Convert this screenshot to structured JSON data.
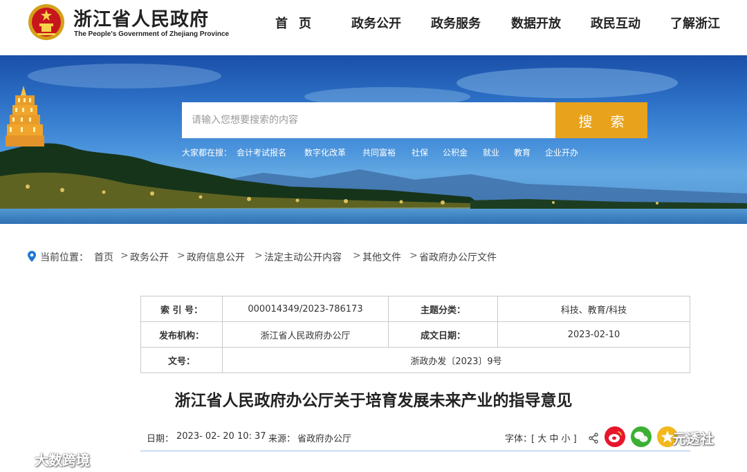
{
  "header": {
    "title": "浙江省人民政府",
    "subtitle": "The People's Government of Zhejiang Province",
    "nav": [
      "首页",
      "政务公开",
      "政务服务",
      "数据开放",
      "政民互动",
      "了解浙江"
    ]
  },
  "search": {
    "placeholder": "请输入您想要搜索的内容",
    "button_label": "搜 索",
    "hot_label": "大家都在搜：",
    "hot_links": [
      "会计考试报名",
      "数字化改革",
      "共同富裕",
      "社保",
      "公积金",
      "就业",
      "教育",
      "企业开办"
    ]
  },
  "breadcrumb": {
    "prefix": "当前位置：",
    "items": [
      "首页",
      "政务公开",
      "政府信息公开",
      "法定主动公开内容",
      "其他文件",
      "省政府办公厅文件"
    ],
    "separator": ">"
  },
  "info": {
    "index_label": "索 引 号：",
    "index_value": "000014349/2023-786173",
    "topic_label": "主题分类：",
    "topic_value": "科技、教育/科技",
    "issuer_label": "发布机构：",
    "issuer_value": "浙江省人民政府办公厅",
    "date_label": "成文日期：",
    "date_value": "2023-02-10",
    "docno_label": "文号：",
    "docno_value": "浙政办发〔2023〕9号"
  },
  "article": {
    "title": "浙江省人民政府办公厅关于培育发展未来产业的指导意见",
    "date_label": "日期：",
    "date_value": "2023- 02- 20 10: 37",
    "source_label": "来源：",
    "source_value": "省政府办公厅",
    "font_label": "字体：",
    "font_options": "[ 大 中 小 ]"
  },
  "watermarks": {
    "right": "元透社",
    "left": "大数跨境"
  },
  "colors": {
    "accent": "#e8a21c",
    "sky": "#2f74c9",
    "weibo": "#e6162d",
    "wechat": "#3cb034",
    "qzone": "#f4b81c"
  }
}
